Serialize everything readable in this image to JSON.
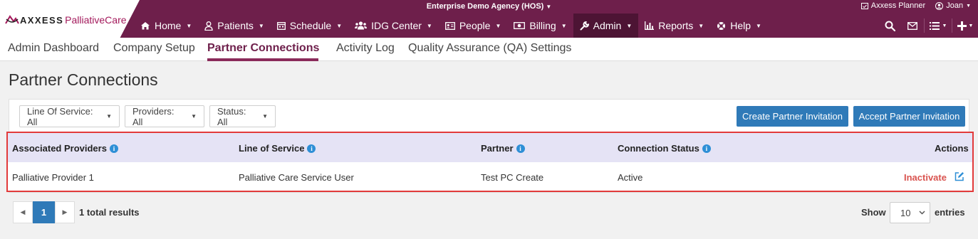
{
  "header": {
    "agency": "Enterprise Demo Agency (HOS)",
    "planner": "Axxess Planner",
    "user": "Joan",
    "logo_brand": "AXXESS",
    "logo_product": "PalliativeCare"
  },
  "nav": {
    "home": "Home",
    "patients": "Patients",
    "schedule": "Schedule",
    "idg": "IDG Center",
    "people": "People",
    "billing": "Billing",
    "admin": "Admin",
    "reports": "Reports",
    "help": "Help"
  },
  "subnav": {
    "admin_dashboard": "Admin Dashboard",
    "company_setup": "Company Setup",
    "partner_connections": "Partner Connections",
    "activity_log": "Activity Log",
    "qa_settings": "Quality Assurance (QA) Settings"
  },
  "page": {
    "title": "Partner Connections"
  },
  "filters": {
    "line_of_service": "Line Of Service: All",
    "providers": "Providers: All",
    "status": "Status: All"
  },
  "buttons": {
    "create_invitation": "Create Partner Invitation",
    "accept_invitation": "Accept Partner Invitation"
  },
  "table": {
    "headers": {
      "providers": "Associated Providers",
      "line_of_service": "Line of Service",
      "partner": "Partner",
      "status": "Connection Status",
      "actions": "Actions"
    },
    "rows": [
      {
        "provider": "Palliative Provider 1",
        "line_of_service": "Palliative Care Service User",
        "partner": "Test PC Create",
        "status": "Active",
        "action": "Inactivate"
      }
    ]
  },
  "pagination": {
    "current_page": "1",
    "total": "1 total results",
    "show_label": "Show",
    "page_size": "10",
    "entries_label": "entries"
  },
  "colors": {
    "topbar": "#6e1f4b",
    "accent": "#2f7ab8",
    "danger": "#d9534f",
    "highlight_border": "#e23a3a"
  }
}
